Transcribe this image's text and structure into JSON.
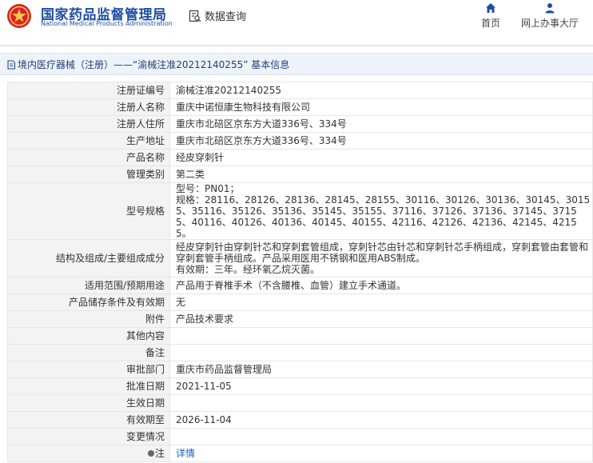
{
  "header": {
    "brand_cn": "国家药品监督管理局",
    "brand_en": "National Medical Products Administration",
    "data_query": "数据查询",
    "nav": {
      "home": "首页",
      "online": "网上办事大厅"
    }
  },
  "breadcrumb": {
    "category": "境内医疗器械（注册）",
    "sep": " —— ",
    "title": "“渝械注准20212140255” 基本信息"
  },
  "rows": [
    {
      "label": "注册证编号",
      "value": "渝械注准20212140255"
    },
    {
      "label": "注册人名称",
      "value": "重庆中诺恒康生物科技有限公司"
    },
    {
      "label": "注册人住所",
      "value": "重庆市北碚区京东方大道336号、334号"
    },
    {
      "label": "生产地址",
      "value": "重庆市北碚区京东方大道336号、334号"
    },
    {
      "label": "产品名称",
      "value": "经皮穿刺针"
    },
    {
      "label": "管理类别",
      "value": "第二类"
    },
    {
      "label": "型号规格",
      "value_lines": [
        "型号：PN01；",
        "规格：28116、28126、28136、28145、28155、30116、30126、30136、30145、30155、35116、35126、35136、35145、35155、37116、37126、37136、37145、37155、40116、40126、40136、40145、40155、42116、42126、42136、42145、42155。"
      ]
    },
    {
      "label": "结构及组成/主要组成成分",
      "value_lines": [
        "经皮穿刺针由穿刺针芯和穿刺套管组成，穿刺针芯由针芯和穿刺针芯手柄组成，穿刺套管由套管和穿刺套管手柄组成。产品采用医用不锈钢和医用ABS制成。",
        "有效期：三年。经环氧乙烷灭菌。"
      ]
    },
    {
      "label": "适用范围/预期用途",
      "value": "产品用于脊椎手术（不含腰椎、血管）建立手术通道。"
    },
    {
      "label": "产品储存条件及有效期",
      "value": "无"
    },
    {
      "label": "附件",
      "value": "产品技术要求"
    },
    {
      "label": "其他内容",
      "value": ""
    },
    {
      "label": "备注",
      "value": ""
    },
    {
      "label": "审批部门",
      "value": "重庆市药品监督管理局"
    },
    {
      "label": "批准日期",
      "value": "2021-11-05"
    },
    {
      "label": "生效日期",
      "value": ""
    },
    {
      "label": "有效期至",
      "value": "2026-11-04"
    },
    {
      "label": "变更情况",
      "value": ""
    }
  ],
  "note": {
    "label": "注",
    "link": "详情"
  },
  "colors": {
    "brand_blue": "#1f4fa3",
    "link_blue": "#1d5fb6",
    "logo_red": "#d9242a",
    "label_bg": "#f3f3f3"
  }
}
